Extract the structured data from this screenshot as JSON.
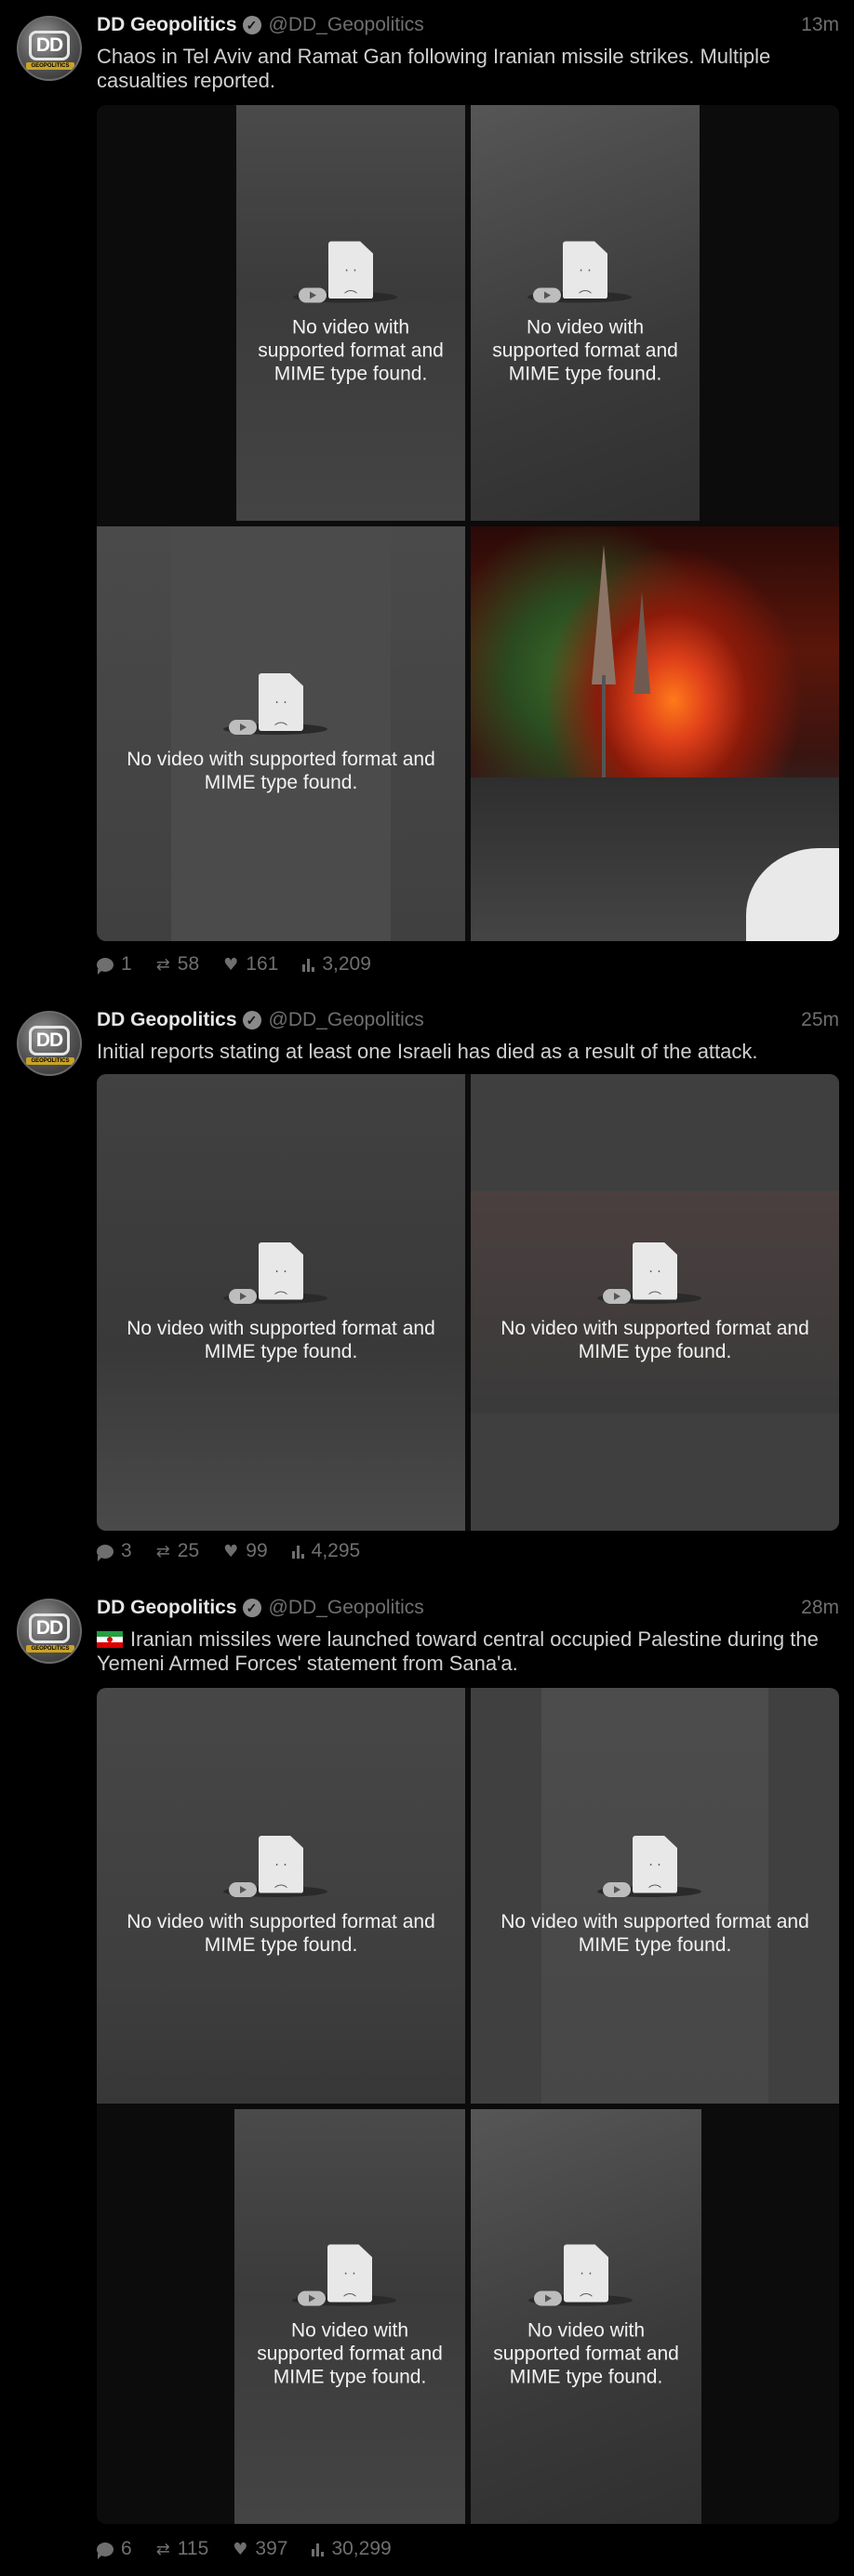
{
  "tweets": [
    {
      "author": "DD Geopolitics",
      "handle": "@DD_Geopolitics",
      "time": "13m",
      "text": "Chaos in Tel Aviv and Ramat Gan following Iranian missile strikes. Multiple casualties reported.",
      "media": [
        {
          "type": "video-error",
          "message": "No video with supported format and MIME type found."
        },
        {
          "type": "video-error",
          "message": "No video with supported format and MIME type found."
        },
        {
          "type": "video-error",
          "message": "No video with supported format and MIME type found."
        },
        {
          "type": "image",
          "description": "night street fire"
        }
      ],
      "replies": "1",
      "retweets": "58",
      "likes": "161",
      "views": "3,209"
    },
    {
      "author": "DD Geopolitics",
      "handle": "@DD_Geopolitics",
      "time": "25m",
      "text": "Initial reports stating at least one Israeli has died as a result of the attack.",
      "media": [
        {
          "type": "video-error",
          "message": "No video with supported format and MIME type found."
        },
        {
          "type": "video-error",
          "message": "No video with supported format and MIME type found."
        }
      ],
      "replies": "3",
      "retweets": "25",
      "likes": "99",
      "views": "4,295"
    },
    {
      "author": "DD Geopolitics",
      "handle": "@DD_Geopolitics",
      "time": "28m",
      "flag": "iran-flag-icon",
      "text": "Iranian missiles were launched toward central occupied Palestine during the Yemeni Armed Forces' statement from Sana'a.",
      "media": [
        {
          "type": "video-error",
          "message": "No video with supported format and MIME type found."
        },
        {
          "type": "video-error",
          "message": "No video with supported format and MIME type found."
        },
        {
          "type": "video-error",
          "message": "No video with supported format and MIME type found."
        },
        {
          "type": "video-error",
          "message": "No video with supported format and MIME type found."
        }
      ],
      "replies": "6",
      "retweets": "115",
      "likes": "397",
      "views": "30,299"
    }
  ],
  "icons": {
    "reply": "reply-icon",
    "retweet": "retweet-icon",
    "like": "heart-icon",
    "views": "views-icon",
    "verified": "verified-badge-icon",
    "broken_video": "broken-file-icon"
  },
  "colors": {
    "background": "#000000",
    "muted": "#6f6f6f",
    "text": "#d0d0d0"
  }
}
